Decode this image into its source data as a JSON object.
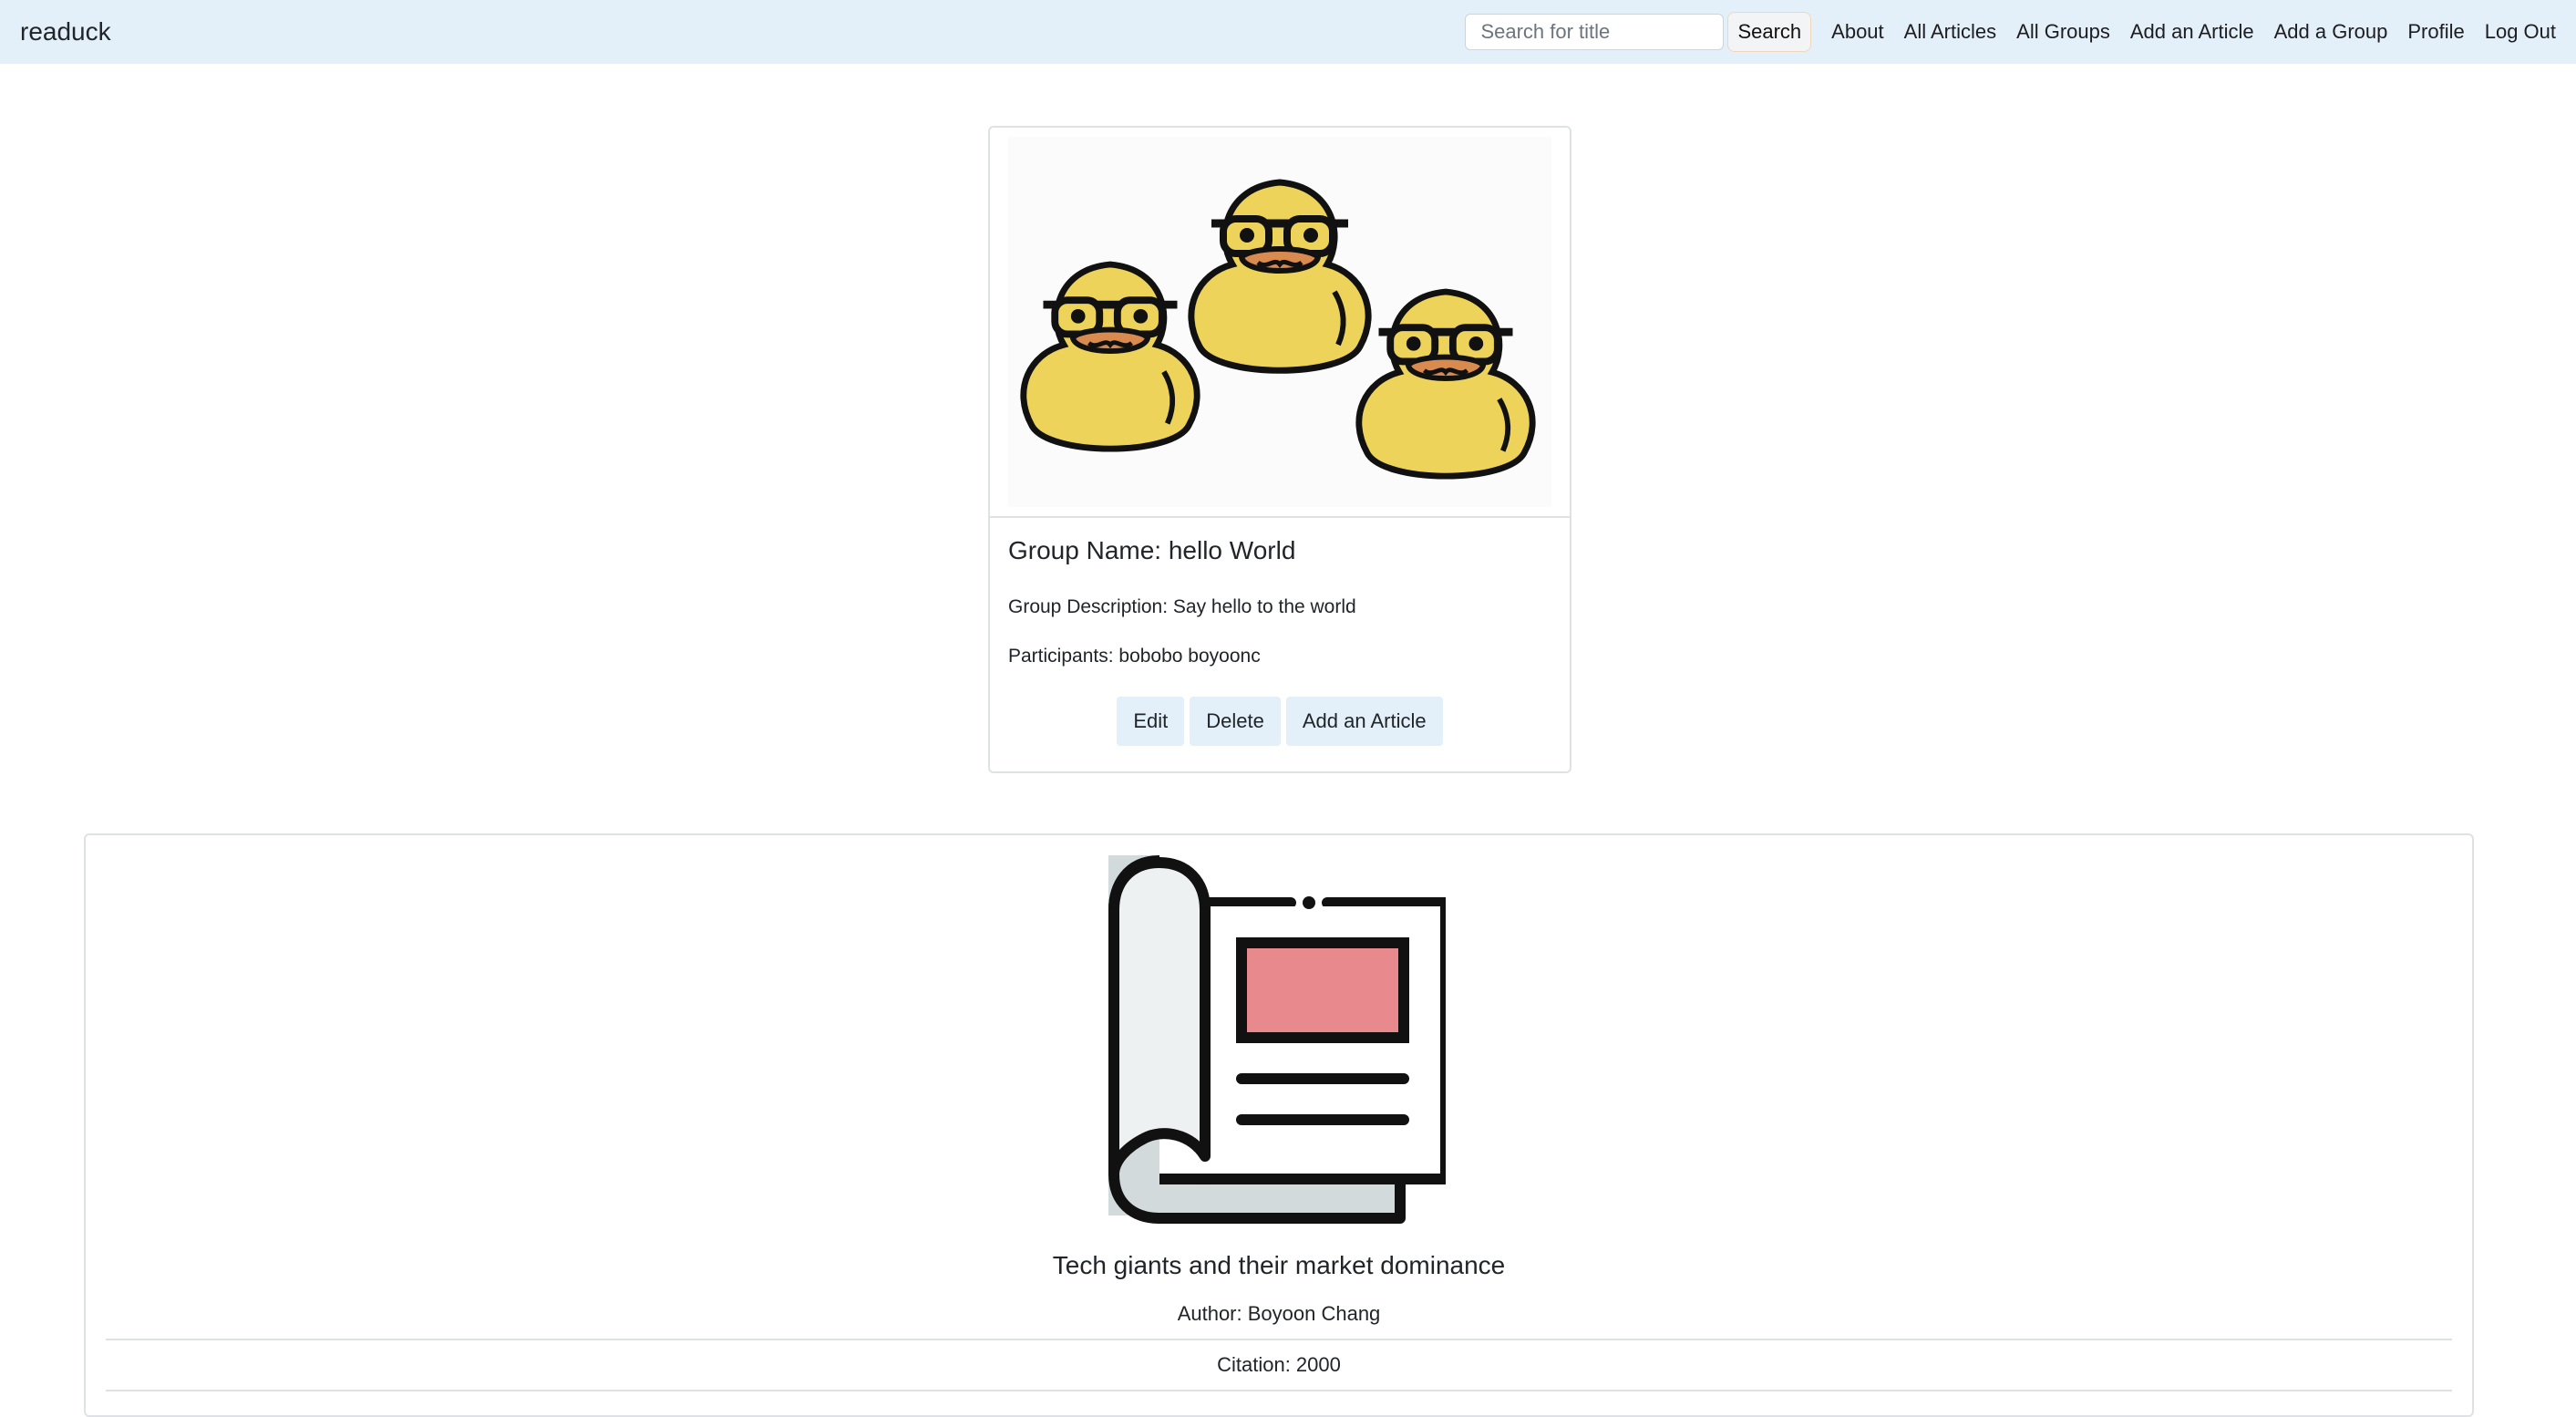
{
  "navbar": {
    "brand": "readuck",
    "search": {
      "placeholder": "Search for title",
      "value": "",
      "button_label": "Search"
    },
    "links": [
      "About",
      "All Articles",
      "All Groups",
      "Add an Article",
      "Add a Group",
      "Profile",
      "Log Out"
    ]
  },
  "group": {
    "image_icon": "three-ducks-with-glasses-illustration",
    "name": "Group Name: hello World",
    "description": "Group Description: Say hello to the world",
    "participants": "Participants: bobobo boyoonc",
    "actions": {
      "edit": "Edit",
      "delete": "Delete",
      "add_article": "Add an Article"
    }
  },
  "article": {
    "image_icon": "newspaper-icon",
    "title": "Tech giants and their market dominance",
    "author": "Author: Boyoon Chang",
    "citation": "Citation: 2000"
  },
  "colors": {
    "navbar_bg": "#e3f0fa",
    "button_bg": "#e3f0fa",
    "duck_yellow": "#edd35a",
    "beak_orange": "#d98a4f",
    "newspaper_pink": "#e7898d"
  }
}
